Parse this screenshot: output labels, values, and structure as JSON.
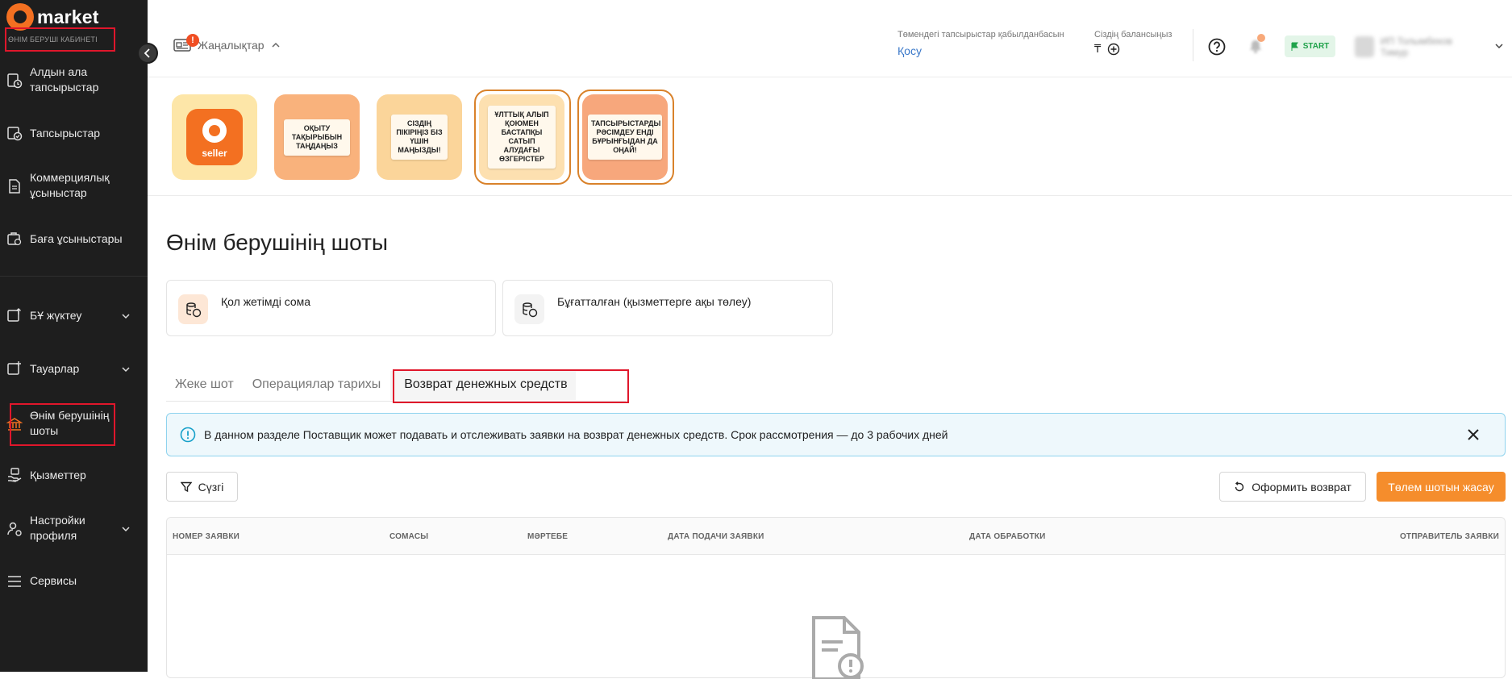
{
  "sidebar": {
    "brand": "market",
    "cabinet_label": "ӨНІМ БЕРУШІ КАБИНЕТІ",
    "items": [
      {
        "label": "Алдын ала тапсырыстар",
        "icon": "preorder-icon"
      },
      {
        "label": "Тапсырыстар",
        "icon": "orders-icon"
      },
      {
        "label": "Коммерциялық ұсыныстар",
        "icon": "document-icon"
      },
      {
        "label": "Баға ұсыныстары",
        "icon": "price-icon"
      },
      {
        "label": "БҰ жүктеу",
        "icon": "upload-icon"
      },
      {
        "label": "Тауарлар",
        "icon": "products-icon"
      },
      {
        "label": "Өнім берушінің шоты",
        "icon": "bank-icon"
      },
      {
        "label": "Қызметтер",
        "icon": "services-icon"
      },
      {
        "label": "Настройки профиля",
        "icon": "profile-settings-icon"
      },
      {
        "label": "Сервисы",
        "icon": "menu-icon"
      }
    ]
  },
  "header": {
    "news_label": "Жаңалықтар",
    "news_badge": "!",
    "orders_label": "Төмендегі тапсырыстар қабылданбасын",
    "orders_link": "Қосу",
    "balance_label": "Сіздің балансыңыз",
    "balance_currency": "₸",
    "start_label": "START",
    "user_name": "ИП Толымбеков Тимур"
  },
  "stories": [
    {
      "text": "seller",
      "bg": "#fde6a8"
    },
    {
      "text": "ОҚЫТУ ТАҚЫРЫБЫН ТАҢДАҢЫЗ",
      "bg": "#f9b27c"
    },
    {
      "text": "СІЗДІҢ ПІКІРІҢІЗ БІЗ ҮШІН МАҢЫЗДЫ!",
      "bg": "#fbd59a"
    },
    {
      "text": "ҰЛТТЫҚ АЛЫП ҚОЮМЕН БАСТАПҚЫ САТЫП АЛУДАҒЫ ӨЗГЕРІСТЕР",
      "bg": "#fde0b0"
    },
    {
      "text": "ТАПСЫРЫСТАРДЫ РӘСІМДЕУ ЕНДІ БҰРЫНҒЫДАН ДА ОҢАЙ!",
      "bg": "#f7a77c"
    }
  ],
  "page": {
    "title": "Өнім берушінің шоты",
    "cards": [
      {
        "label": "Қол жетімді сома"
      },
      {
        "label": "Бұғатталған (қызметтерге ақы төлеу)"
      }
    ],
    "tabs": [
      "Жеке шот",
      "Операциялар тарихы",
      "Возврат денежных средств"
    ],
    "active_tab": "Возврат денежных средств",
    "alert_text": "В данном разделе Поставщик может подавать и отслеживать заявки на возврат денежных средств. Срок рассмотрения — до 3 рабочих дней",
    "filter_label": "Сүзгі",
    "refund_button": "Оформить возврат",
    "invoice_button": "Төлем шотын жасау",
    "table_headers": [
      "НОМЕР ЗАЯВКИ",
      "СОМАСЫ",
      "МӘРТЕБЕ",
      "ДАТА ПОДАЧИ ЗАЯВКИ",
      "ДАТА ОБРАБОТКИ",
      "ОТПРАВИТЕЛЬ ЗАЯВКИ"
    ]
  },
  "colors": {
    "accent": "#f37021",
    "sidebar_bg": "#1e1e1e",
    "highlight": "#e0162b",
    "alert_border": "#8fd3ee",
    "primary_button": "#f58d2c"
  }
}
